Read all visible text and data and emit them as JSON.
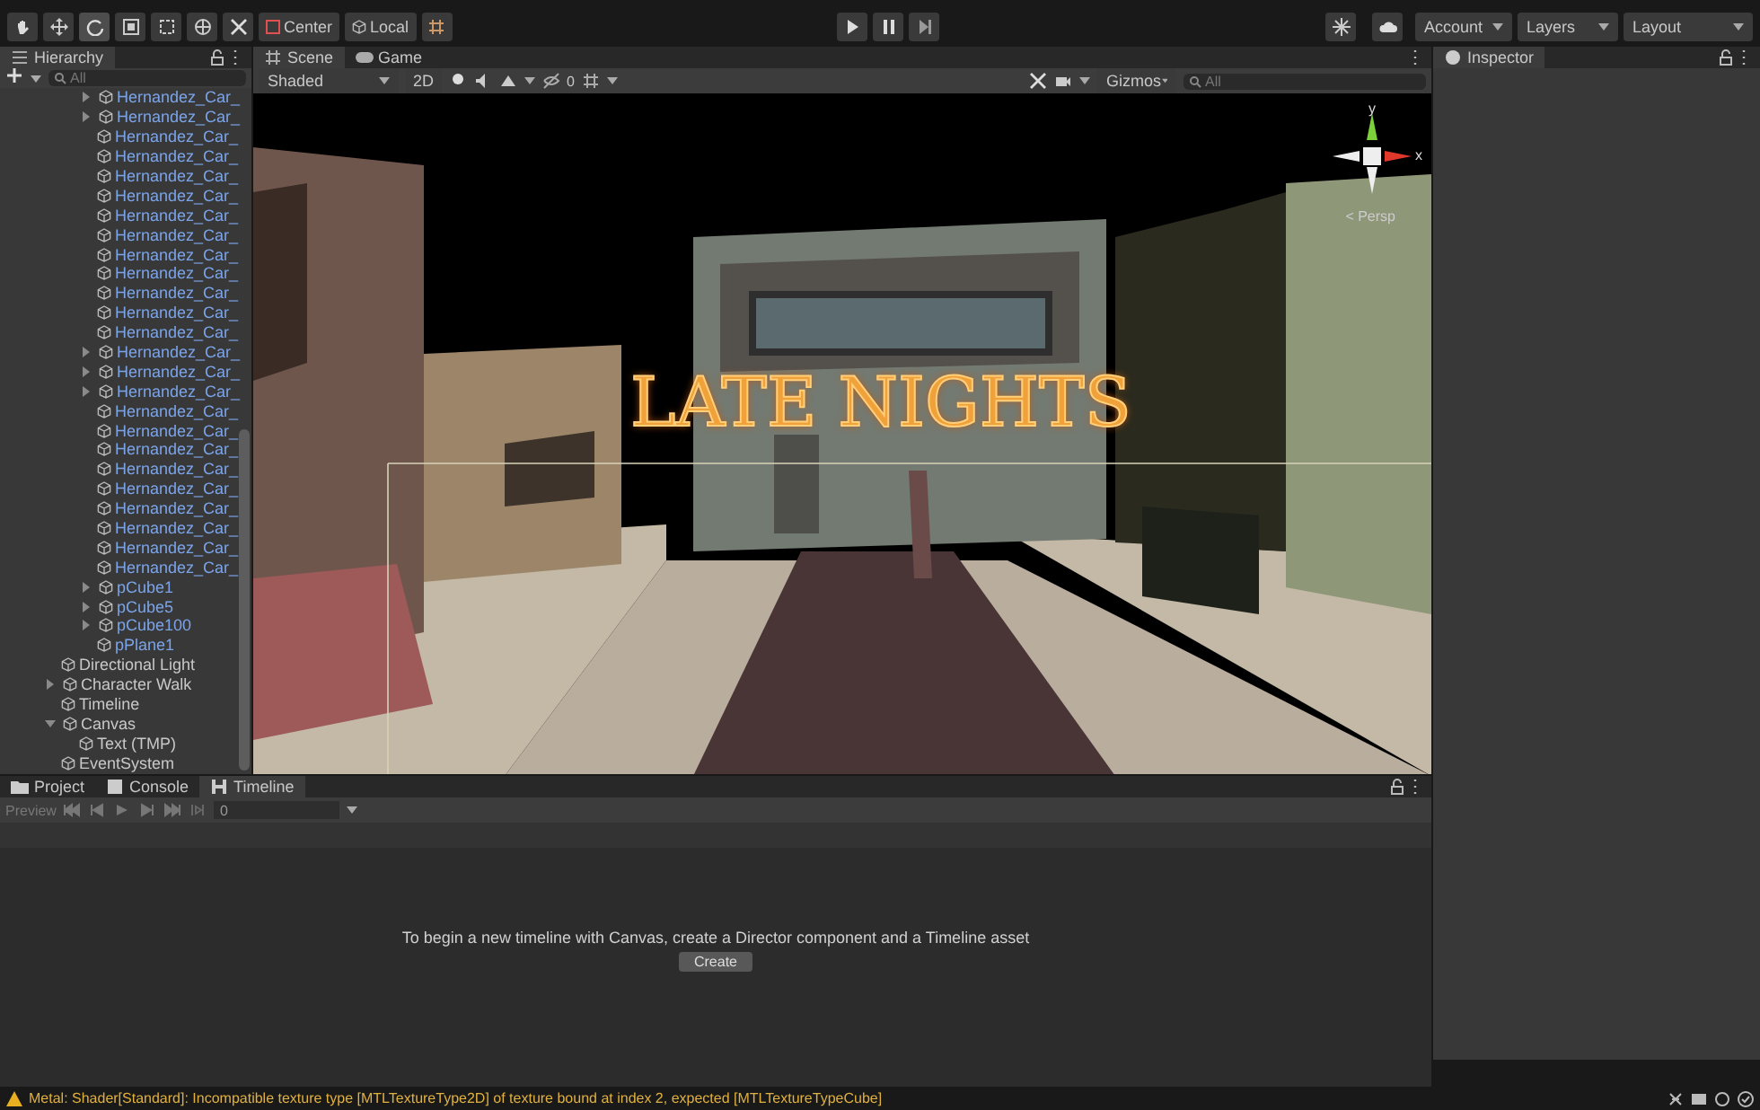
{
  "toolbar": {
    "tools": [
      {
        "kind": "hand",
        "selected": false
      },
      {
        "kind": "move",
        "selected": false
      },
      {
        "kind": "rotate",
        "selected": true
      },
      {
        "kind": "scale",
        "selected": false
      },
      {
        "kind": "rect",
        "selected": false
      },
      {
        "kind": "transform",
        "selected": false
      },
      {
        "kind": "custom",
        "selected": false
      }
    ],
    "pivot": "Center",
    "space": "Local",
    "account": "Account",
    "layers": "Layers",
    "layout": "Layout"
  },
  "hierarchy": {
    "title": "Hierarchy",
    "search_placeholder": "All",
    "items": [
      {
        "children": [
          {
            "label": "Hernandez_Car_",
            "kind": "prefab",
            "expanded": false
          },
          {
            "label": "Hernandez_Car_",
            "kind": "prefab",
            "expanded": false
          },
          {
            "label": "Hernandez_Car_",
            "kind": "prefab"
          },
          {
            "label": "Hernandez_Car_",
            "kind": "prefab"
          },
          {
            "label": "Hernandez_Car_",
            "kind": "prefab"
          },
          {
            "label": "Hernandez_Car_",
            "kind": "prefab"
          },
          {
            "label": "Hernandez_Car_",
            "kind": "prefab"
          },
          {
            "label": "Hernandez_Car_",
            "kind": "prefab"
          },
          {
            "label": "Hernandez_Car_",
            "kind": "prefab"
          },
          {
            "label": "Hernandez_Car_",
            "kind": "prefab"
          },
          {
            "label": "Hernandez_Car_",
            "kind": "prefab"
          },
          {
            "label": "Hernandez_Car_",
            "kind": "prefab"
          },
          {
            "label": "Hernandez_Car_",
            "kind": "prefab"
          },
          {
            "label": "Hernandez_Car_",
            "kind": "prefab",
            "expanded": false
          },
          {
            "label": "Hernandez_Car_",
            "kind": "prefab",
            "expanded": false
          },
          {
            "label": "Hernandez_Car_",
            "kind": "prefab",
            "expanded": false
          },
          {
            "label": "Hernandez_Car_",
            "kind": "prefab"
          },
          {
            "label": "Hernandez_Car_",
            "kind": "prefab"
          },
          {
            "label": "Hernandez_Car_",
            "kind": "prefab"
          },
          {
            "label": "Hernandez_Car_",
            "kind": "prefab"
          },
          {
            "label": "Hernandez_Car_",
            "kind": "prefab"
          },
          {
            "label": "Hernandez_Car_",
            "kind": "prefab"
          },
          {
            "label": "Hernandez_Car_",
            "kind": "prefab"
          },
          {
            "label": "Hernandez_Car_",
            "kind": "prefab"
          },
          {
            "label": "Hernandez_Car_",
            "kind": "prefab"
          },
          {
            "label": "pCube1",
            "kind": "prefab",
            "expanded": false
          },
          {
            "label": "pCube5",
            "kind": "prefab",
            "expanded": false
          },
          {
            "label": "pCube100",
            "kind": "prefab",
            "expanded": false
          },
          {
            "label": "pPlane1",
            "kind": "prefab"
          }
        ]
      },
      {
        "label": "Directional Light",
        "kind": "object"
      },
      {
        "label": "Character Walk",
        "kind": "object",
        "expanded": false
      },
      {
        "label": "Timeline",
        "kind": "object"
      },
      {
        "label": "Canvas",
        "kind": "object",
        "expanded": true,
        "children": [
          {
            "label": "Text (TMP)",
            "kind": "object"
          }
        ]
      },
      {
        "label": "EventSystem",
        "kind": "object"
      }
    ]
  },
  "scene": {
    "tabs": [
      {
        "label": "Scene",
        "selected": true
      },
      {
        "label": "Game",
        "selected": false
      }
    ],
    "shading": "Shaded",
    "mode_2d": "2D",
    "fx_count": "0",
    "gizmos": "Gizmos",
    "search_placeholder": "All",
    "overlay_text": "LATE NIGHTS",
    "axis_y": "y",
    "axis_x": "x",
    "projection": "< Persp"
  },
  "inspector": {
    "title": "Inspector"
  },
  "bottom": {
    "tabs": [
      {
        "label": "Project",
        "selected": false
      },
      {
        "label": "Console",
        "selected": false
      },
      {
        "label": "Timeline",
        "selected": true
      }
    ],
    "preview": "Preview",
    "frame": "0",
    "message": "To begin a new timeline with Canvas, create a Director component and a Timeline asset",
    "button": "Create"
  },
  "status": {
    "warning": "Metal: Shader[Standard]: Incompatible texture type [MTLTextureType2D] of texture bound at index 2, expected [MTLTextureTypeCube]"
  }
}
